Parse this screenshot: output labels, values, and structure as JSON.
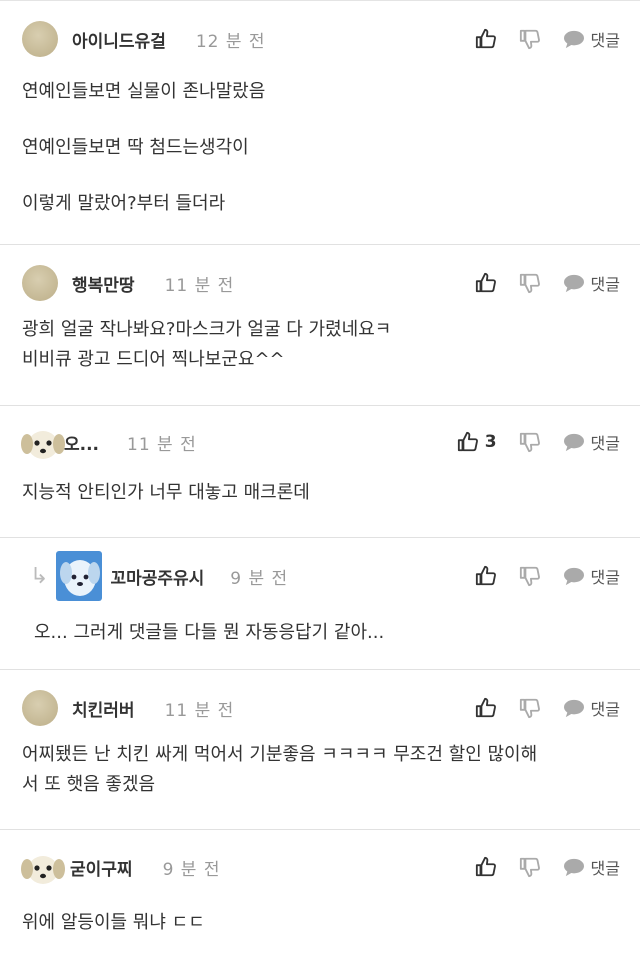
{
  "reply_label": "댓글",
  "comments": [
    {
      "name": "아이니드유걸",
      "time": "12 분 전",
      "lines": [
        "연예인들보면 실물이 존나말랐음",
        "연예인들보면 딱 첨드는생각이",
        "이렇게 말랐어?부터 들더라"
      ]
    },
    {
      "name": "행복만땅",
      "time": "11 분 전",
      "lines": [
        "광희 얼굴 작나봐요?마스크가 얼굴 다 가렸네요ㅋ",
        "비비큐 광고 드디어 찍나보군요^^"
      ]
    },
    {
      "name": "오...",
      "time": "11 분 전",
      "likes": "3",
      "lines": [
        "지능적 안티인가 너무 대놓고 매크론데"
      ]
    },
    {
      "name": "꼬마공주유시",
      "time": "9 분 전",
      "lines": [
        "오... 그러게 댓글들 다들 뭔 자동응답기 같아..."
      ]
    },
    {
      "name": "치킨러버",
      "time": "11 분 전",
      "lines": [
        "어찌됐든 난 치킨 싸게 먹어서 기분좋음 ㅋㅋㅋㅋ 무조건 할인 많이해",
        "서 또 햇음 좋겠음"
      ]
    },
    {
      "name": "굳이구찌",
      "time": "9 분 전",
      "lines": [
        "위에 알등이들 뭐냐 ㄷㄷ"
      ]
    }
  ]
}
